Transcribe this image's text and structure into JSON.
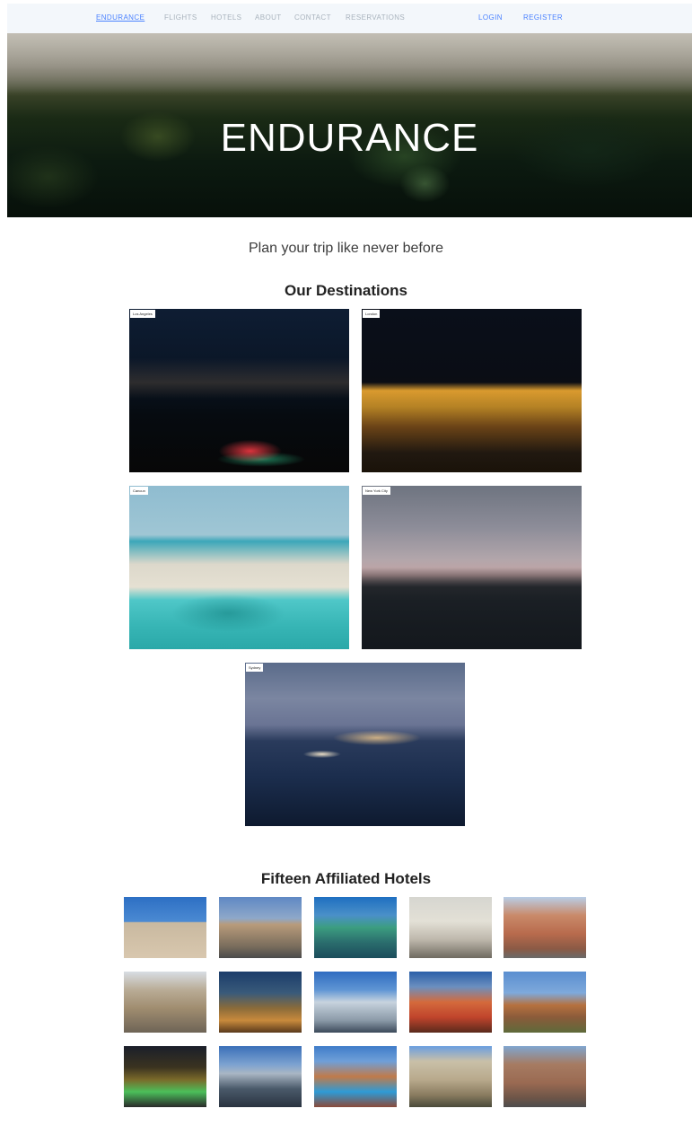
{
  "nav": {
    "brand": "ENDURANCE",
    "links": [
      "FLIGHTS",
      "HOTELS",
      "ABOUT",
      "CONTACT",
      "RESERVATIONS"
    ],
    "login": "LOGIN",
    "register": "REGISTER"
  },
  "hero": {
    "title": "ENDURANCE"
  },
  "tagline": "Plan your trip like never before",
  "destinations": {
    "heading": "Our Destinations",
    "items": [
      {
        "label": "Los Angeles"
      },
      {
        "label": "London"
      },
      {
        "label": "Cancun"
      },
      {
        "label": "New York City"
      },
      {
        "label": "Sydney"
      }
    ]
  },
  "hotels": {
    "heading": "Fifteen Affiliated Hotels",
    "count": 15
  },
  "colors": {
    "accent": "#4c83ff",
    "nav_muted": "#a9b3bd",
    "nav_bg": "#f3f7fb"
  }
}
